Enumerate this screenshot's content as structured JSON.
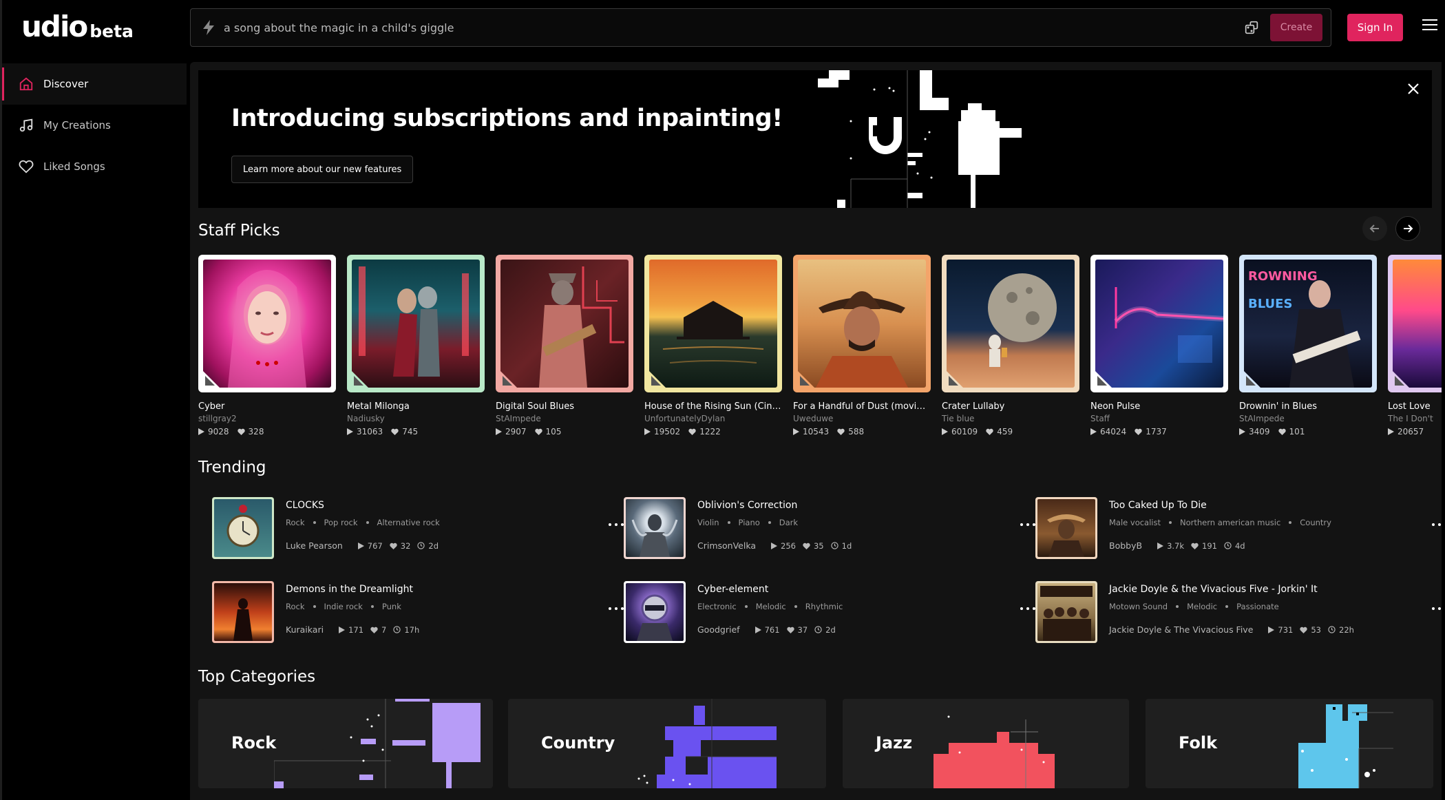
{
  "brand": {
    "name": "udio",
    "tag": "beta"
  },
  "sidebar": {
    "items": [
      {
        "label": "Discover",
        "icon": "home-icon",
        "active": true
      },
      {
        "label": "My Creations",
        "icon": "music-note-icon",
        "active": false
      },
      {
        "label": "Liked Songs",
        "icon": "heart-icon",
        "active": false
      }
    ]
  },
  "topbar": {
    "prompt_placeholder": "a song about the magic in a child's giggle",
    "create_label": "Create",
    "signin_label": "Sign In"
  },
  "banner": {
    "title": "Introducing subscriptions and inpainting!",
    "button_label": "Learn more about our new features"
  },
  "staff_picks": {
    "title": "Staff Picks",
    "items": [
      {
        "title": "Cyber",
        "artist": "stillgray2",
        "plays": "9028",
        "likes": "328"
      },
      {
        "title": "Metal Milonga",
        "artist": "Nadiusky",
        "plays": "31063",
        "likes": "745"
      },
      {
        "title": "Digital Soul Blues",
        "artist": "StAImpede",
        "plays": "2907",
        "likes": "105"
      },
      {
        "title": "House of the Rising Sun (Cinem...",
        "artist": "UnfortunatelyDylan",
        "plays": "19502",
        "likes": "1222"
      },
      {
        "title": "For a Handful of Dust (movie sc...",
        "artist": "Uweduwe",
        "plays": "10543",
        "likes": "588"
      },
      {
        "title": "Crater Lullaby",
        "artist": "Tie blue",
        "plays": "60109",
        "likes": "459"
      },
      {
        "title": "Neon Pulse",
        "artist": "Staff",
        "plays": "64024",
        "likes": "1737"
      },
      {
        "title": "Drownin' in Blues",
        "artist": "StAImpede",
        "plays": "3409",
        "likes": "101"
      },
      {
        "title": "Lost Love",
        "artist": "The I Don't",
        "plays": "20657",
        "likes": ""
      }
    ]
  },
  "trending": {
    "title": "Trending",
    "items": [
      {
        "title": "CLOCKS",
        "tags": [
          "Rock",
          "Pop rock",
          "Alternative rock"
        ],
        "author": "Luke Pearson",
        "plays": "767",
        "likes": "32",
        "age": "2d"
      },
      {
        "title": "Oblivion's Correction",
        "tags": [
          "Violin",
          "Piano",
          "Dark"
        ],
        "author": "CrimsonVelka",
        "plays": "256",
        "likes": "35",
        "age": "1d"
      },
      {
        "title": "Too Caked Up To Die",
        "tags": [
          "Male vocalist",
          "Northern american music",
          "Country"
        ],
        "author": "BobbyB",
        "plays": "3.7k",
        "likes": "191",
        "age": "4d"
      },
      {
        "title": "Demons in the Dreamlight",
        "tags": [
          "Rock",
          "Indie rock",
          "Punk"
        ],
        "author": "Kuraikari",
        "plays": "171",
        "likes": "7",
        "age": "17h"
      },
      {
        "title": "Cyber-element",
        "tags": [
          "Electronic",
          "Melodic",
          "Rhythmic"
        ],
        "author": "Goodgrief",
        "plays": "761",
        "likes": "37",
        "age": "2d"
      },
      {
        "title": "Jackie Doyle & the Vivacious Five - Jorkin' It",
        "tags": [
          "Motown Sound",
          "Melodic",
          "Passionate"
        ],
        "author": "Jackie Doyle & The Vivacious Five",
        "plays": "731",
        "likes": "53",
        "age": "22h"
      }
    ]
  },
  "categories": {
    "title": "Top Categories",
    "items": [
      {
        "label": "Rock",
        "color": "#b79cf7"
      },
      {
        "label": "Country",
        "color": "#6a52f0"
      },
      {
        "label": "Jazz",
        "color": "#f2525e"
      },
      {
        "label": "Folk",
        "color": "#5ec6ec"
      }
    ]
  },
  "colors": {
    "accent": "#e0245e",
    "create_disabled": "#7d1235"
  }
}
